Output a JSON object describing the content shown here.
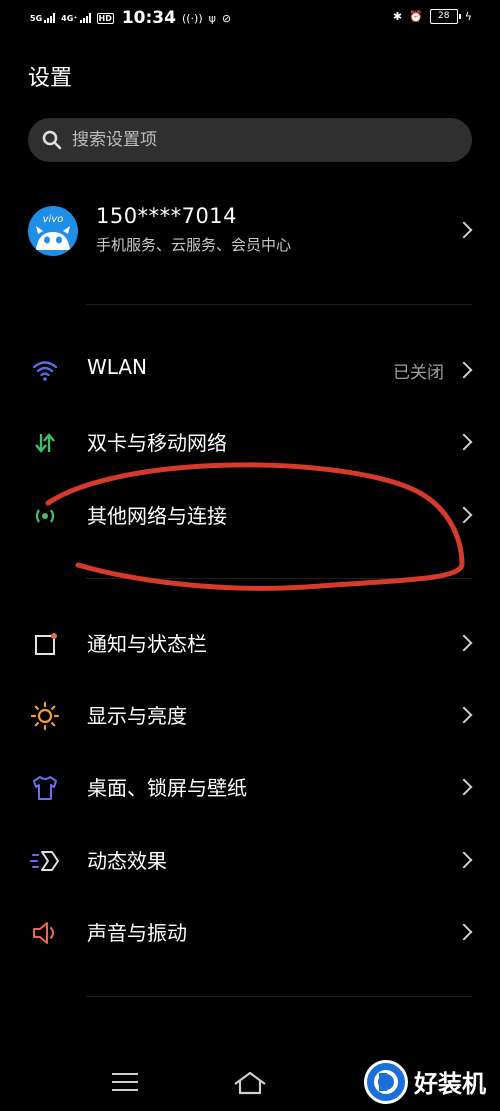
{
  "status_bar": {
    "net1": "5G",
    "net2": "4G⁺",
    "hd": "HD",
    "time": "10:34",
    "battery": "28"
  },
  "page_title": "设置",
  "search": {
    "placeholder": "搜索设置项"
  },
  "account": {
    "avatar_brand": "vivo",
    "name": "150****7014",
    "subtitle": "手机服务、云服务、会员中心"
  },
  "items": [
    {
      "label": "WLAN",
      "value": "已关闭",
      "icon": "wifi-icon",
      "color": "#5b6ee6"
    },
    {
      "label": "双卡与移动网络",
      "value": "",
      "icon": "mobile-data-icon",
      "color": "#3fbf6a"
    },
    {
      "label": "其他网络与连接",
      "value": "",
      "icon": "other-network-icon",
      "color": "#3fbf6a"
    },
    {
      "label": "通知与状态栏",
      "value": "",
      "icon": "notification-icon",
      "color": "#e86a4a"
    },
    {
      "label": "显示与亮度",
      "value": "",
      "icon": "sun-icon",
      "color": "#f0a030"
    },
    {
      "label": "桌面、锁屏与壁纸",
      "value": "",
      "icon": "shirt-icon",
      "color": "#6a6ee8"
    },
    {
      "label": "动态效果",
      "value": "",
      "icon": "motion-icon",
      "color": "#6a6ee8"
    },
    {
      "label": "声音与振动",
      "value": "",
      "icon": "speaker-icon",
      "color": "#e86a4a"
    }
  ],
  "watermark": {
    "text": "好装机"
  },
  "annotation_color": "#d63a2a"
}
